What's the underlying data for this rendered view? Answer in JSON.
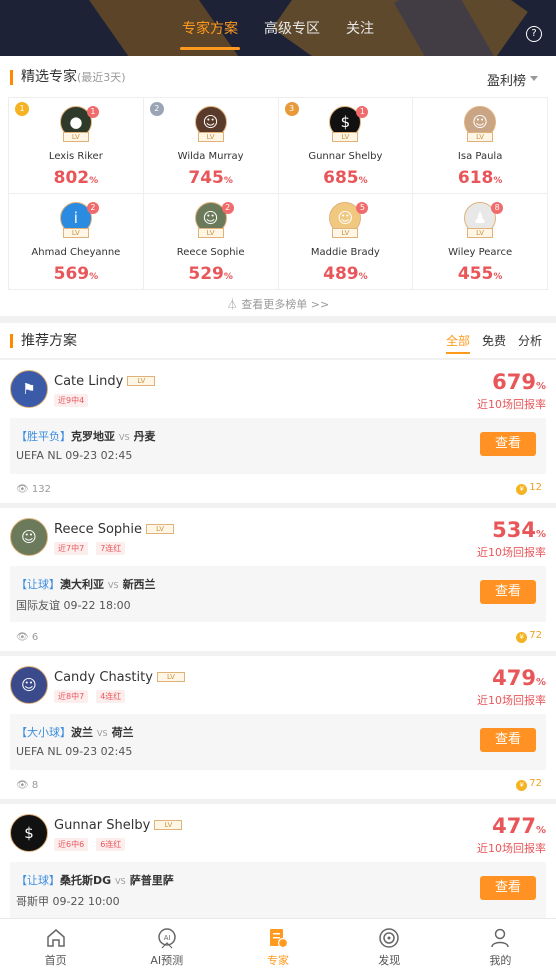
{
  "header": {
    "tabs": [
      "专家方案",
      "高级专区",
      "关注"
    ],
    "active_tab": 0,
    "help_icon": "question-icon"
  },
  "experts": {
    "title": "精选专家",
    "title_note": "(最近3天)",
    "sort_label": "盈利榜",
    "more_link": "查看更多榜单 >>",
    "items": [
      {
        "rank": "1",
        "name": "Lexis Riker",
        "pct": "802",
        "unit": "%",
        "badge": "1",
        "avatar_color": "#2f3a2a",
        "avatar_glyph": "●",
        "lv": "LV"
      },
      {
        "rank": "2",
        "name": "Wilda Murray",
        "pct": "745",
        "unit": "%",
        "badge": "",
        "avatar_color": "#5a3a2a",
        "avatar_glyph": "☺",
        "lv": "LV"
      },
      {
        "rank": "3",
        "name": "Gunnar Shelby",
        "pct": "685",
        "unit": "%",
        "badge": "1",
        "avatar_color": "#111111",
        "avatar_glyph": "$",
        "lv": "LV"
      },
      {
        "rank": "",
        "name": "Isa Paula",
        "pct": "618",
        "unit": "%",
        "badge": "",
        "avatar_color": "#c9a585",
        "avatar_glyph": "☺",
        "lv": "LV"
      },
      {
        "rank": "",
        "name": "Ahmad Cheyanne",
        "pct": "569",
        "unit": "%",
        "badge": "2",
        "avatar_color": "#2b8be0",
        "avatar_glyph": "i",
        "lv": "LV"
      },
      {
        "rank": "",
        "name": "Reece Sophie",
        "pct": "529",
        "unit": "%",
        "badge": "2",
        "avatar_color": "#6a7a5a",
        "avatar_glyph": "☺",
        "lv": "LV"
      },
      {
        "rank": "",
        "name": "Maddie Brady",
        "pct": "489",
        "unit": "%",
        "badge": "5",
        "avatar_color": "#f0c880",
        "avatar_glyph": "☺",
        "lv": "LV"
      },
      {
        "rank": "",
        "name": "Wiley Pearce",
        "pct": "455",
        "unit": "%",
        "badge": "8",
        "avatar_color": "#e8e8e8",
        "avatar_glyph": "♟",
        "lv": "LV"
      }
    ]
  },
  "recommend": {
    "title": "推荐方案",
    "filters": [
      "全部",
      "免费",
      "分析"
    ],
    "rate_label": "近10场回报率",
    "view_label": "查看",
    "cards": [
      {
        "name": "Cate Lindy",
        "tags": [
          "近9中4"
        ],
        "rate": "679",
        "unit": "%",
        "play": "【胜平负】",
        "home": "克罗地亚",
        "away": "丹麦",
        "league_time": "UEFA  NL  09-23 02:45",
        "views": "132",
        "price": "12",
        "avatar_color": "#3b5ba8",
        "avatar_glyph": "⚑"
      },
      {
        "name": "Reece Sophie",
        "tags": [
          "近7中7",
          "7连红"
        ],
        "rate": "534",
        "unit": "%",
        "play": "【让球】",
        "home": "澳大利亚",
        "away": "新西兰",
        "league_time": "国际友谊  09-22 18:00",
        "views": "6",
        "price": "72",
        "avatar_color": "#6a7a5a",
        "avatar_glyph": "☺"
      },
      {
        "name": "Candy Chastity",
        "tags": [
          "近8中7",
          "4连红"
        ],
        "rate": "479",
        "unit": "%",
        "play": "【大小球】",
        "home": "波兰",
        "away": "荷兰",
        "league_time": "UEFA  NL  09-23 02:45",
        "views": "8",
        "price": "72",
        "avatar_color": "#3a4a8a",
        "avatar_glyph": "☺"
      },
      {
        "name": "Gunnar Shelby",
        "tags": [
          "近6中6",
          "6连红"
        ],
        "rate": "477",
        "unit": "%",
        "play": "【让球】",
        "home": "桑托斯DG",
        "away": "萨普里萨",
        "league_time": "哥斯甲  09-22 10:00",
        "views": "",
        "price": "",
        "avatar_color": "#111111",
        "avatar_glyph": "$"
      }
    ]
  },
  "bottom_nav": [
    {
      "label": "首页",
      "icon": "home-icon"
    },
    {
      "label": "AI预测",
      "icon": "ai-icon"
    },
    {
      "label": "专家",
      "icon": "expert-icon",
      "active": true
    },
    {
      "label": "发现",
      "icon": "discover-icon"
    },
    {
      "label": "我的",
      "icon": "profile-icon"
    }
  ],
  "colors": {
    "accent": "#ff9a1e",
    "rate_red": "#e8565a",
    "header_bg": "#1d2236"
  }
}
